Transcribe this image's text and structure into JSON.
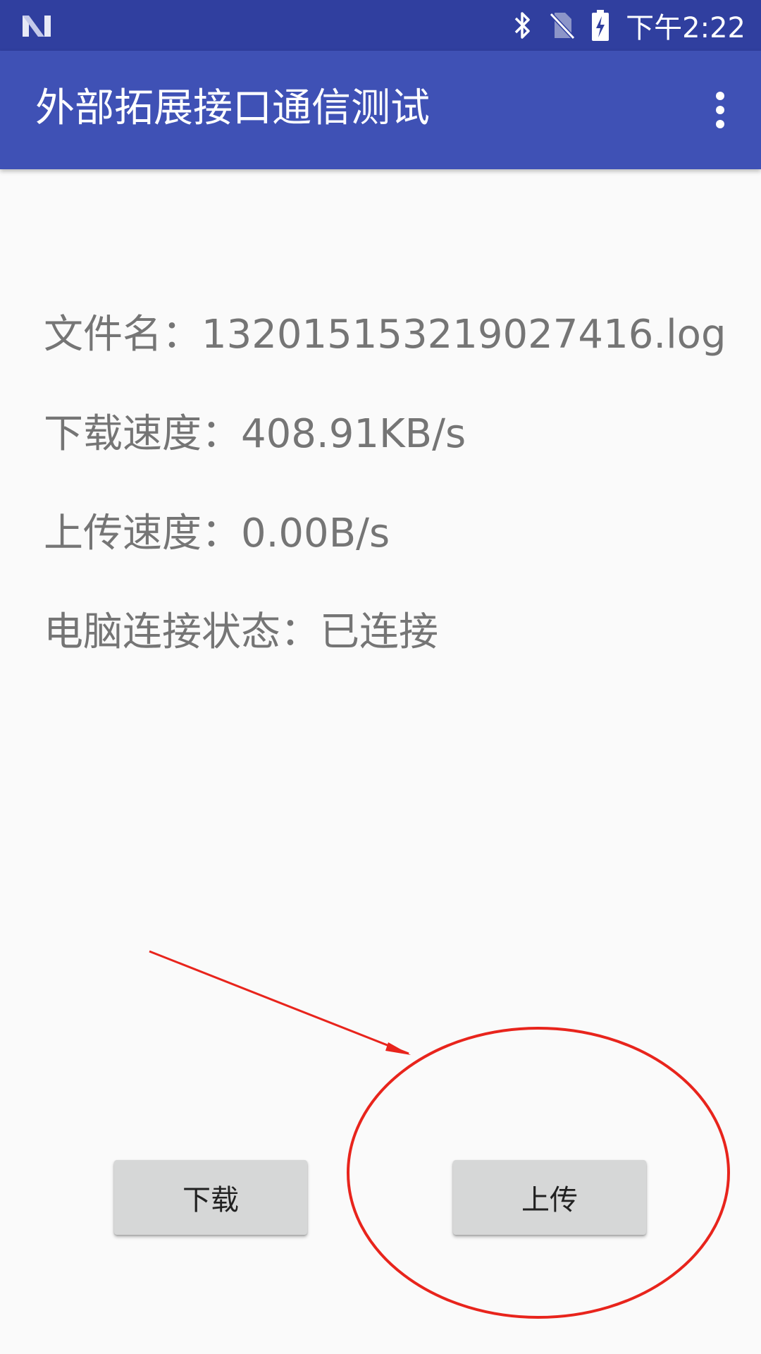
{
  "status_bar": {
    "time": "下午2:22",
    "icons": [
      "n-logo-icon",
      "bluetooth-icon",
      "no-sim-icon",
      "battery-charging-icon"
    ]
  },
  "app_bar": {
    "title": "外部拓展接口通信测试",
    "menu_icon": "more-vert-icon"
  },
  "info": {
    "file_name_label": "文件名：",
    "file_name_value": "13201515321902741​6.log",
    "download_speed_label": "下载速度：",
    "download_speed_value": "408.91KB/s",
    "upload_speed_label": "上传速度：",
    "upload_speed_value": "0.00B/s",
    "pc_status_label": "电脑连接状态：",
    "pc_status_value": "已连接"
  },
  "buttons": {
    "download_label": "下载",
    "upload_label": "上传"
  },
  "annotation": {
    "color": "#e8241c",
    "shapes": [
      "arrow",
      "ellipse"
    ]
  },
  "colors": {
    "status_bar": "#303f9f",
    "app_bar": "#3f51b5",
    "background": "#fafafa",
    "button": "#d6d7d7",
    "info_text": "#757575"
  }
}
